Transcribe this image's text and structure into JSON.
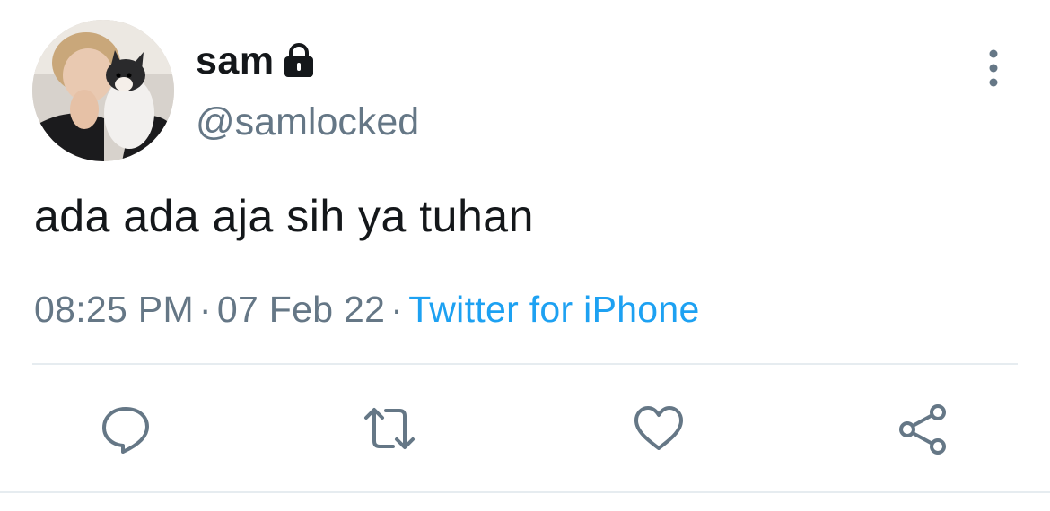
{
  "tweet": {
    "display_name": "sam",
    "handle": "@samlocked",
    "text": "ada ada aja sih ya tuhan",
    "time": "08:25 PM",
    "separator": "·",
    "date": "07 Feb 22",
    "source": "Twitter for iPhone",
    "protected": true
  },
  "icons": {
    "lock": "lock-icon",
    "more": "more-vertical-icon",
    "reply": "reply-icon",
    "retweet": "retweet-icon",
    "like": "heart-icon",
    "share": "share-icon"
  },
  "colors": {
    "text": "#14171a",
    "secondary": "#657786",
    "link": "#1da1f2",
    "divider": "#e6ecf0"
  }
}
